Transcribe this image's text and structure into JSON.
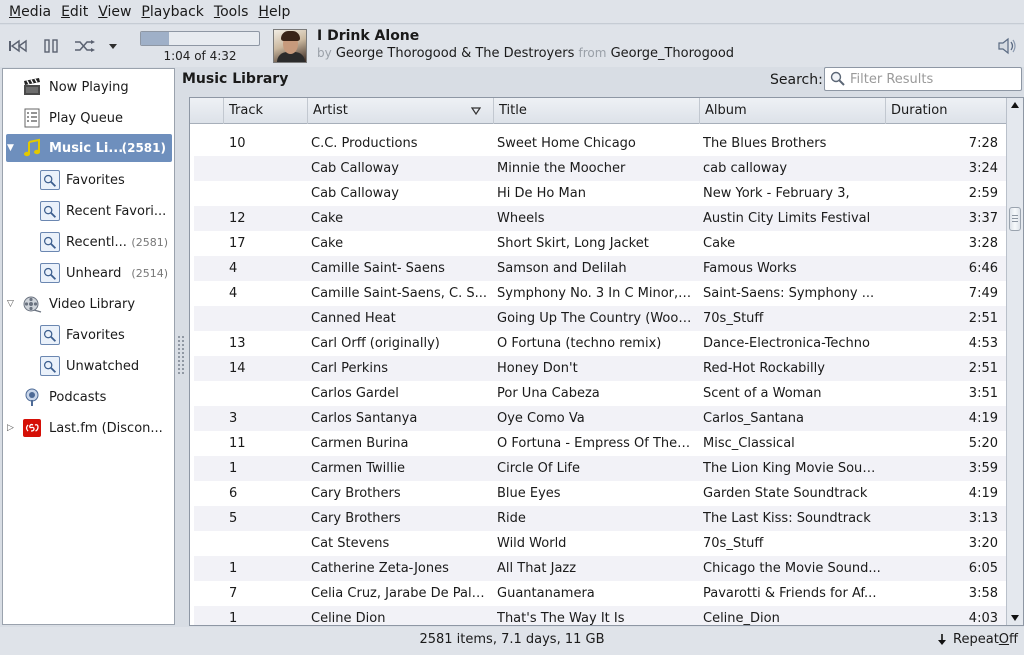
{
  "menubar": {
    "items": [
      {
        "mnemonic": "M",
        "rest": "edia"
      },
      {
        "mnemonic": "E",
        "rest": "dit"
      },
      {
        "mnemonic": "V",
        "rest": "iew"
      },
      {
        "mnemonic": "P",
        "rest": "layback"
      },
      {
        "mnemonic": "T",
        "rest": "ools"
      },
      {
        "mnemonic": "H",
        "rest": "elp"
      }
    ]
  },
  "player": {
    "position_label": "1:04 of 4:32",
    "progress": 0.2353,
    "track_title": "I Drink Alone",
    "by_label": "by",
    "artist": "George Thorogood & The Destroyers",
    "from_label": "from",
    "album": "George_Thorogood"
  },
  "sidebar": {
    "now_playing": "Now Playing",
    "play_queue": "Play Queue",
    "music_library": {
      "label": "Music Li...",
      "count": "(2581)"
    },
    "favorites": "Favorites",
    "recent_favorites": "Recent Favori...",
    "recently": {
      "label": "Recentl...",
      "count": "(2581)"
    },
    "unheard": {
      "label": "Unheard",
      "count": "(2514)"
    },
    "video_library": "Video Library",
    "video_favorites": "Favorites",
    "unwatched": "Unwatched",
    "podcasts": "Podcasts",
    "lastfm": "Last.fm (Discon..."
  },
  "main": {
    "title": "Music Library",
    "search_label": "Search:",
    "search_placeholder": "Filter Results",
    "columns": {
      "track": "Track",
      "artist": "Artist",
      "title": "Title",
      "album": "Album",
      "duration": "Duration"
    },
    "rows": [
      {
        "track": "10",
        "artist": "C.C. Productions",
        "title": "Sweet Home Chicago",
        "album": "The Blues Brothers",
        "duration": "7:28"
      },
      {
        "track": "",
        "artist": "Cab Calloway",
        "title": "Minnie the Moocher",
        "album": "cab calloway",
        "duration": "3:24"
      },
      {
        "track": "",
        "artist": "Cab Calloway",
        "title": "Hi De Ho Man",
        "album": "New York - February 3,",
        "duration": "2:59"
      },
      {
        "track": "12",
        "artist": "Cake",
        "title": "Wheels",
        "album": "Austin City Limits Festival",
        "duration": "3:37"
      },
      {
        "track": "17",
        "artist": "Cake",
        "title": "Short Skirt, Long Jacket",
        "album": "Cake",
        "duration": "3:28"
      },
      {
        "track": "4",
        "artist": "Camille Saint- Saens",
        "title": "Samson and Delilah",
        "album": "Famous Works",
        "duration": "6:46"
      },
      {
        "track": "4",
        "artist": "Camille Saint-Saens, C. S...",
        "title": "Symphony No. 3 In C Minor, ...",
        "album": "Saint-Saens: Symphony ...",
        "duration": "7:49"
      },
      {
        "track": "",
        "artist": "Canned Heat",
        "title": "Going Up The Country (Wood...",
        "album": "70s_Stuff",
        "duration": "2:51"
      },
      {
        "track": "13",
        "artist": "Carl Orff (originally)",
        "title": "O Fortuna (techno remix)",
        "album": "Dance-Electronica-Techno",
        "duration": "4:53"
      },
      {
        "track": "14",
        "artist": "Carl Perkins",
        "title": "Honey Don't",
        "album": "Red-Hot Rockabilly",
        "duration": "2:51"
      },
      {
        "track": "",
        "artist": "Carlos Gardel",
        "title": "Por Una Cabeza",
        "album": "Scent of a Woman",
        "duration": "3:51"
      },
      {
        "track": "3",
        "artist": "Carlos Santanya",
        "title": "Oye Como Va",
        "album": "Carlos_Santana",
        "duration": "4:19"
      },
      {
        "track": "11",
        "artist": "Carmen Burina",
        "title": "O Fortuna - Empress Of The ...",
        "album": "Misc_Classical",
        "duration": "5:20"
      },
      {
        "track": "1",
        "artist": "Carmen Twillie",
        "title": "Circle Of Life",
        "album": "The Lion King Movie Soun...",
        "duration": "3:59"
      },
      {
        "track": "6",
        "artist": "Cary Brothers",
        "title": "Blue Eyes",
        "album": "Garden State Soundtrack",
        "duration": "4:19"
      },
      {
        "track": "5",
        "artist": "Cary Brothers",
        "title": "Ride",
        "album": "The Last Kiss: Soundtrack",
        "duration": "3:13"
      },
      {
        "track": "",
        "artist": "Cat Stevens",
        "title": "Wild World",
        "album": "70s_Stuff",
        "duration": "3:20"
      },
      {
        "track": "1",
        "artist": "Catherine Zeta-Jones",
        "title": "All That Jazz",
        "album": "Chicago the Movie Sound...",
        "duration": "6:05"
      },
      {
        "track": "7",
        "artist": "Celia Cruz, Jarabe De Palo...",
        "title": "Guantanamera",
        "album": "Pavarotti & Friends for Af...",
        "duration": "3:58"
      },
      {
        "track": "1",
        "artist": "Celine Dion",
        "title": "That's The Way It Is",
        "album": "Celine_Dion",
        "duration": "4:03"
      }
    ]
  },
  "status": {
    "summary": "2581 items, 7.1 days, 11 GB",
    "repeat_label": "Repeat ",
    "repeat_mnemonic": "O",
    "repeat_rest": "ff"
  },
  "colors": {
    "selection": "#6e8fbd",
    "row_alt": "#f2f2f7"
  }
}
